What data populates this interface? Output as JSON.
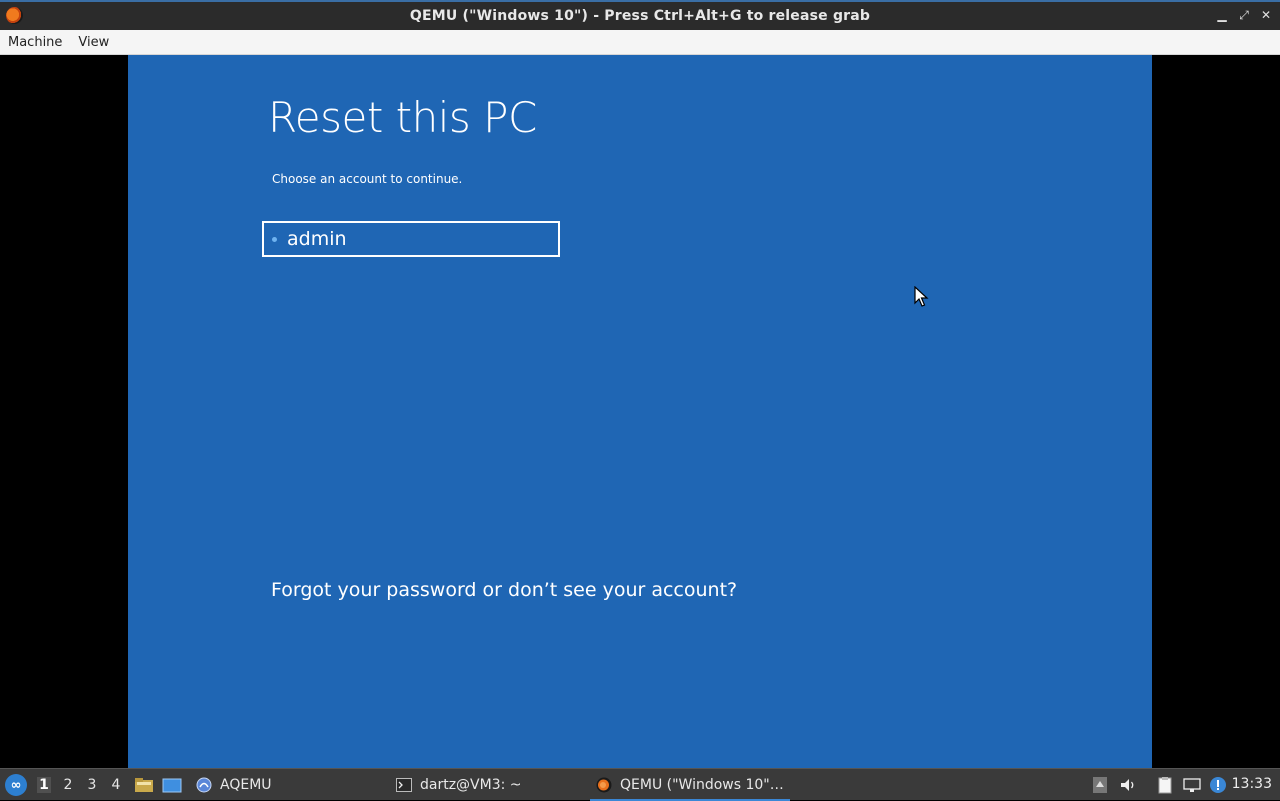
{
  "window": {
    "title": "QEMU (\"Windows 10\") - Press Ctrl+Alt+G to release grab",
    "controls": [
      "minimize-icon",
      "maximize-icon",
      "close-icon"
    ]
  },
  "menubar": {
    "items": [
      "Machine",
      "View"
    ]
  },
  "screen": {
    "heading": "Reset this PC",
    "subtitle": "Choose an account to continue.",
    "account_name": "admin",
    "forgot_link": "Forgot your password or don’t see your account?",
    "background": "#1f66b4"
  },
  "taskbar": {
    "workspaces": [
      "1",
      "2",
      "3",
      "4"
    ],
    "active_workspace": "1",
    "tasks": [
      {
        "label": "AQEMU",
        "icon": "aqemu-icon"
      },
      {
        "label": "dartz@VM3: ~",
        "icon": "terminal-icon"
      },
      {
        "label": "QEMU (\"Windows 10\"…",
        "icon": "qemu-icon",
        "active": true
      }
    ],
    "clock": "13:33",
    "tray_icons": [
      "upload-icon",
      "volume-icon",
      "clipboard-icon",
      "network-icon",
      "updates-icon"
    ]
  }
}
